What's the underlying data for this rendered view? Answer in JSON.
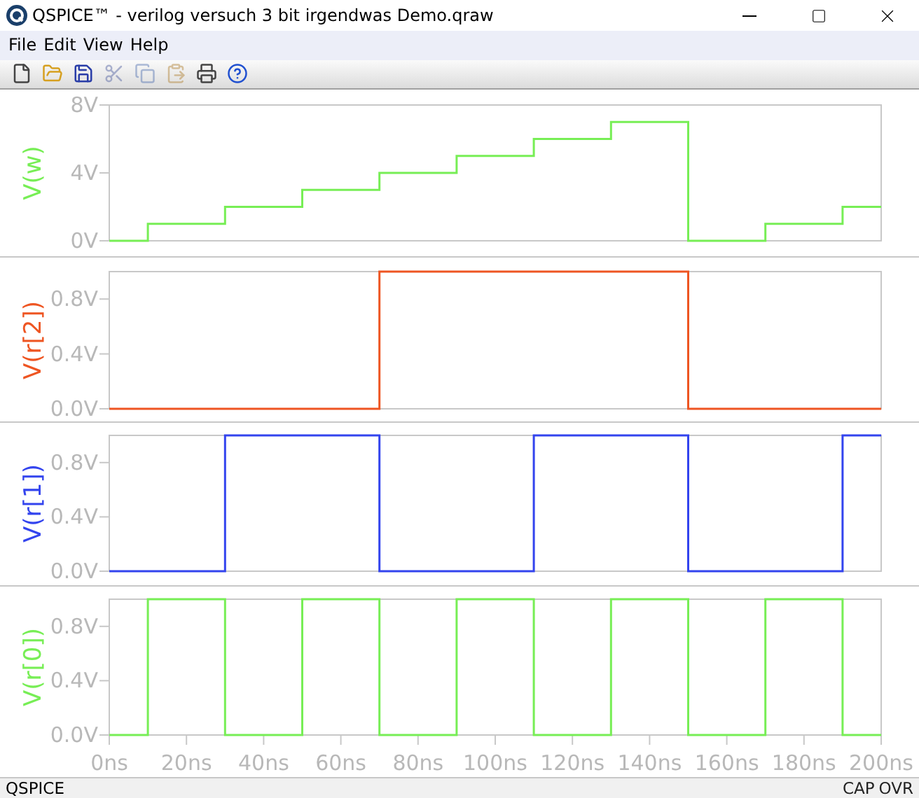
{
  "window": {
    "title": "QSPICE™ - verilog versuch 3 bit irgendwas Demo.qraw"
  },
  "menu": [
    "File",
    "Edit",
    "View",
    "Help"
  ],
  "toolbar": [
    {
      "kind": "new",
      "disabled": false
    },
    {
      "kind": "open",
      "disabled": false
    },
    {
      "kind": "save",
      "disabled": false
    },
    {
      "kind": "cut",
      "disabled": true
    },
    {
      "kind": "copy",
      "disabled": true
    },
    {
      "kind": "paste",
      "disabled": true
    },
    {
      "kind": "print",
      "disabled": false
    },
    {
      "kind": "help",
      "disabled": false
    }
  ],
  "panes": [
    {
      "chart_data": {
        "type": "line",
        "ylabel": "V(w)",
        "xlim": [
          0,
          200
        ],
        "ylim": [
          0,
          8
        ],
        "yticks": [
          {
            "value": 0,
            "label": "0V"
          },
          {
            "value": 4,
            "label": "4V"
          },
          {
            "value": 8,
            "label": "8V"
          }
        ],
        "x": [
          0,
          10,
          10,
          30,
          30,
          50,
          50,
          70,
          70,
          90,
          90,
          110,
          110,
          130,
          130,
          150,
          150,
          170,
          170,
          190,
          190,
          200
        ],
        "series": [
          {
            "color": "#77ee55",
            "values": [
              0,
              0,
              1,
              1,
              2,
              2,
              3,
              3,
              4,
              4,
              5,
              5,
              6,
              6,
              7,
              7,
              0,
              0,
              1,
              1,
              2,
              2
            ]
          }
        ]
      }
    },
    {
      "chart_data": {
        "type": "line",
        "ylabel": "V(r[2])",
        "xlim": [
          0,
          200
        ],
        "ylim": [
          0,
          1
        ],
        "yticks": [
          {
            "value": 0,
            "label": "0.0V"
          },
          {
            "value": 0.4,
            "label": "0.4V"
          },
          {
            "value": 0.8,
            "label": "0.8V"
          }
        ],
        "x": [
          0,
          70,
          70,
          150,
          150,
          200
        ],
        "series": [
          {
            "color": "#ee5522",
            "values": [
              0,
              0,
              1,
              1,
              0,
              0
            ]
          }
        ]
      }
    },
    {
      "chart_data": {
        "type": "line",
        "ylabel": "V(r[1])",
        "xlim": [
          0,
          200
        ],
        "ylim": [
          0,
          1
        ],
        "yticks": [
          {
            "value": 0,
            "label": "0.0V"
          },
          {
            "value": 0.4,
            "label": "0.4V"
          },
          {
            "value": 0.8,
            "label": "0.8V"
          }
        ],
        "x": [
          0,
          30,
          30,
          70,
          70,
          110,
          110,
          150,
          150,
          190,
          190,
          200
        ],
        "series": [
          {
            "color": "#3344ee",
            "values": [
              0,
              0,
              1,
              1,
              0,
              0,
              1,
              1,
              0,
              0,
              1,
              1
            ]
          }
        ]
      }
    },
    {
      "chart_data": {
        "type": "line",
        "ylabel": "V(r[0])",
        "xlim": [
          0,
          200
        ],
        "ylim": [
          0,
          1
        ],
        "yticks": [
          {
            "value": 0,
            "label": "0.0V"
          },
          {
            "value": 0.4,
            "label": "0.4V"
          },
          {
            "value": 0.8,
            "label": "0.8V"
          }
        ],
        "xticks": [
          {
            "value": 0,
            "label": "0ns"
          },
          {
            "value": 20,
            "label": "20ns"
          },
          {
            "value": 40,
            "label": "40ns"
          },
          {
            "value": 60,
            "label": "60ns"
          },
          {
            "value": 80,
            "label": "80ns"
          },
          {
            "value": 100,
            "label": "100ns"
          },
          {
            "value": 120,
            "label": "120ns"
          },
          {
            "value": 140,
            "label": "140ns"
          },
          {
            "value": 160,
            "label": "160ns"
          },
          {
            "value": 180,
            "label": "180ns"
          },
          {
            "value": 200,
            "label": "200ns"
          }
        ],
        "x": [
          0,
          10,
          10,
          30,
          30,
          50,
          50,
          70,
          70,
          90,
          90,
          110,
          110,
          130,
          130,
          150,
          150,
          170,
          170,
          190,
          190,
          200
        ],
        "series": [
          {
            "color": "#77ee55",
            "values": [
              0,
              0,
              1,
              1,
              0,
              0,
              1,
              1,
              0,
              0,
              1,
              1,
              0,
              0,
              1,
              1,
              0,
              0,
              1,
              1,
              0,
              0
            ]
          }
        ]
      }
    }
  ],
  "status_bar": {
    "left": "QSPICE",
    "indicators": [
      "CAP",
      "OVR"
    ]
  }
}
